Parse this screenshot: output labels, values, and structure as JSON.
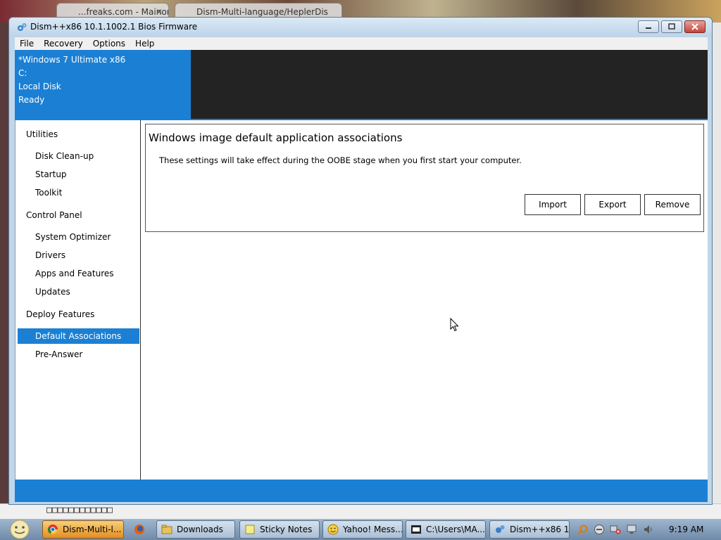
{
  "browser_bg": {
    "tab1": "...freaks.com - Mainone...",
    "tab2": "Dism-Multi-language/HeplerDis",
    "bottom_text": "□□□□□□□□□□□□"
  },
  "window": {
    "title": "Dism++x86 10.1.1002.1 Bios Firmware",
    "menu": [
      "File",
      "Recovery",
      "Options",
      "Help"
    ]
  },
  "info": {
    "line1": "*Windows 7 Ultimate x86",
    "line2": "C:",
    "line3": "Local Disk",
    "line4": "Ready"
  },
  "sidebar": {
    "utilities": "Utilities",
    "disk_cleanup": "Disk Clean-up",
    "startup": "Startup",
    "toolkit": "Toolkit",
    "control_panel": "Control Panel",
    "system_optimizer": "System Optimizer",
    "drivers": "Drivers",
    "apps_features": "Apps and Features",
    "updates": "Updates",
    "deploy_features": "Deploy Features",
    "default_associations": "Default Associations",
    "pre_answer": "Pre-Answer"
  },
  "content": {
    "title": "Windows image default application associations",
    "description": "These settings will take effect during the OOBE stage when you first start your computer.",
    "import_label": "Import",
    "export_label": "Export",
    "remove_label": "Remove"
  },
  "taskbar": {
    "items": [
      "Dism-Multi-l...",
      "Downloads",
      "Sticky Notes",
      "Yahoo! Mess...",
      "C:\\Users\\MA...",
      "Dism++x86 1..."
    ],
    "clock": "9:19 AM"
  },
  "colors": {
    "accent": "#1b80d4",
    "dark": "#232323"
  }
}
